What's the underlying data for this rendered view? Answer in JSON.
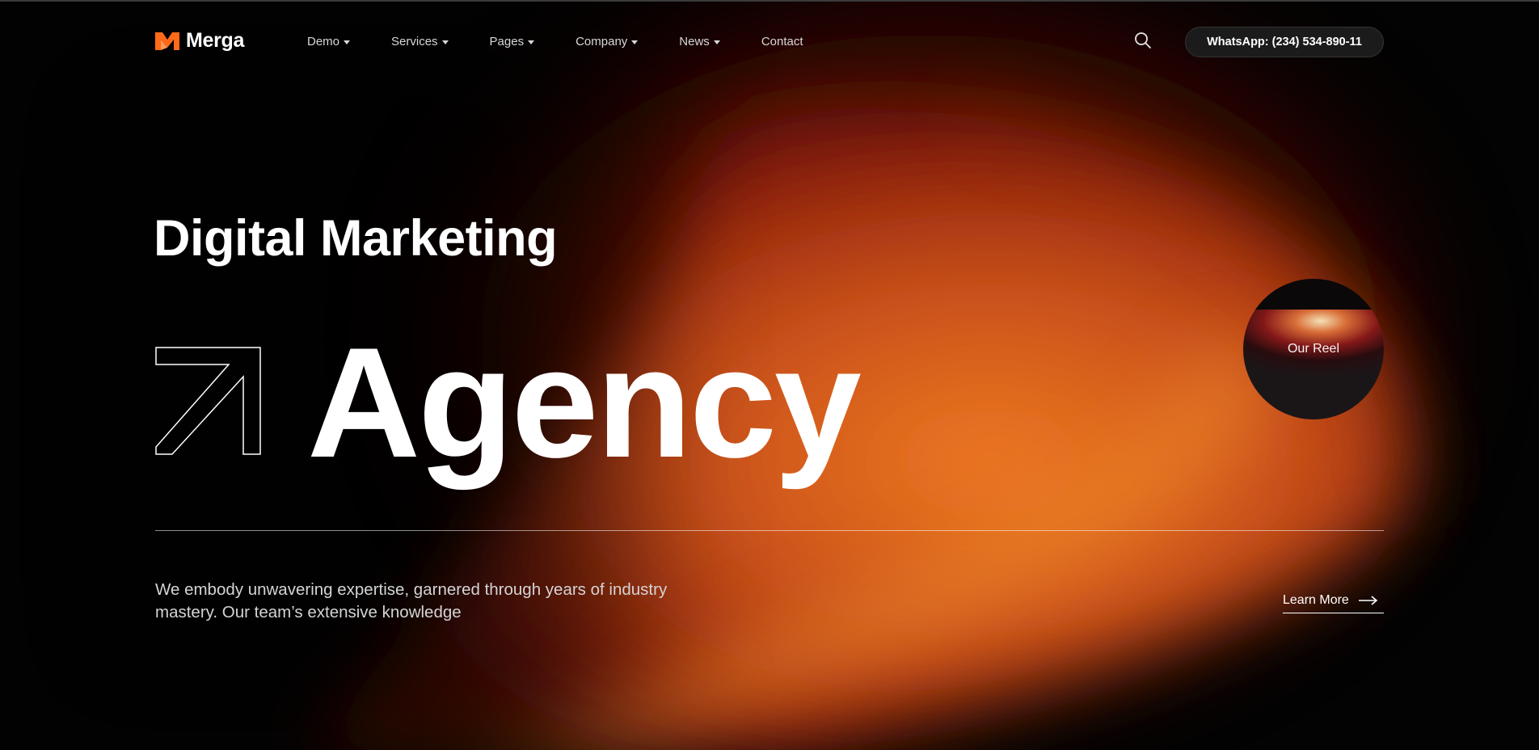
{
  "brand": {
    "name": "Merga",
    "accent": "#ff6a1a"
  },
  "nav": {
    "items": [
      {
        "label": "Demo",
        "has_dropdown": true
      },
      {
        "label": "Services",
        "has_dropdown": true
      },
      {
        "label": "Pages",
        "has_dropdown": true
      },
      {
        "label": "Company",
        "has_dropdown": true
      },
      {
        "label": "News",
        "has_dropdown": true
      },
      {
        "label": "Contact",
        "has_dropdown": false
      }
    ],
    "search_icon": "search-icon",
    "whatsapp_label": "WhatsApp: (234) 534-890-11"
  },
  "hero": {
    "line1": "Digital Marketing",
    "line2": "Agency",
    "arrow_icon": "arrow-up-right-icon",
    "reel_label": "Our Reel",
    "description": "We embody unwavering expertise, garnered through years of industry mastery. Our team’s extensive knowledge",
    "learn_more_label": "Learn More",
    "learn_more_icon": "arrow-right-icon"
  },
  "colors": {
    "background": "#030303",
    "glow_orange": "#e0661e",
    "glow_red": "#7a0f06"
  }
}
